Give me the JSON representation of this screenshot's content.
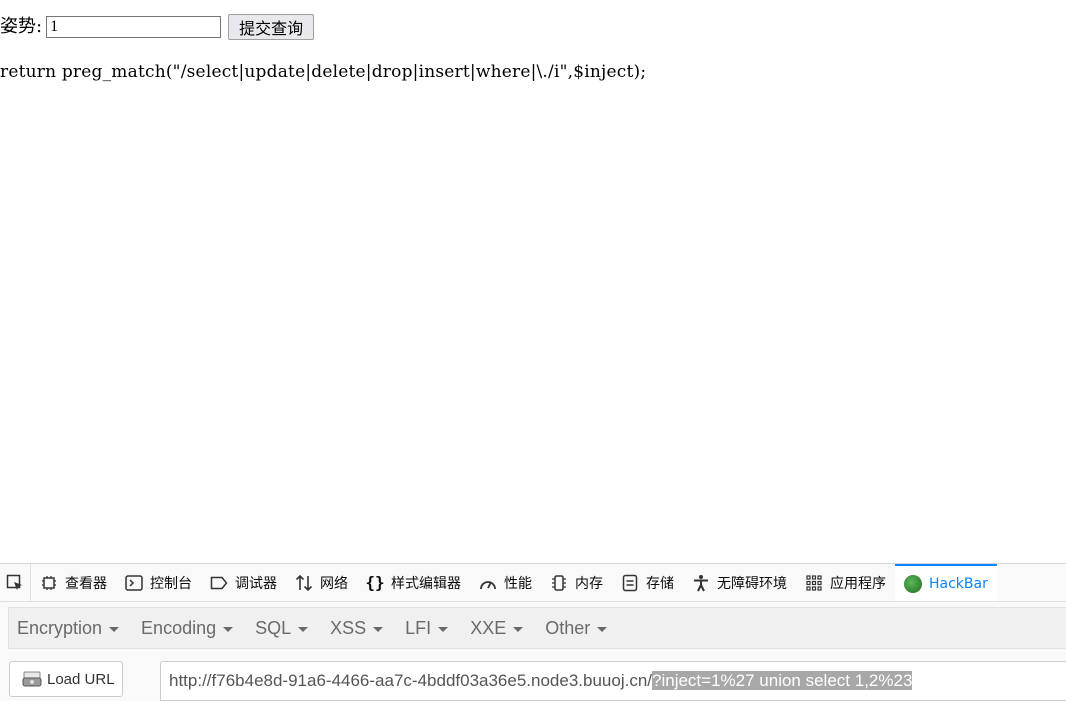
{
  "page": {
    "form_label": "姿势:",
    "input_value": "1",
    "submit_label": "提交查询",
    "code_line": "return preg_match(\"/select|update|delete|drop|insert|where|\\./i\",$inject);"
  },
  "devtools": {
    "tabs": [
      {
        "label": "查看器",
        "icon": "inspector-icon"
      },
      {
        "label": "控制台",
        "icon": "console-icon"
      },
      {
        "label": "调试器",
        "icon": "debugger-icon"
      },
      {
        "label": "网络",
        "icon": "network-icon"
      },
      {
        "label": "样式编辑器",
        "icon": "style-editor-icon"
      },
      {
        "label": "性能",
        "icon": "performance-icon"
      },
      {
        "label": "内存",
        "icon": "memory-icon"
      },
      {
        "label": "存储",
        "icon": "storage-icon"
      },
      {
        "label": "无障碍环境",
        "icon": "accessibility-icon"
      },
      {
        "label": "应用程序",
        "icon": "application-icon"
      },
      {
        "label": "HackBar",
        "icon": "hackbar-icon",
        "active": true
      }
    ]
  },
  "hackbar": {
    "menu": [
      "Encryption",
      "Encoding",
      "SQL",
      "XSS",
      "LFI",
      "XXE",
      "Other"
    ],
    "load_url_label": "Load URL",
    "url_base": "http://f76b4e8d-91a6-4466-aa7c-4bddf03a36e5.node3.buuoj.cn/",
    "url_selected": "?inject=1%27 union select 1,2%23",
    "accent_color": "#0a84ff"
  }
}
